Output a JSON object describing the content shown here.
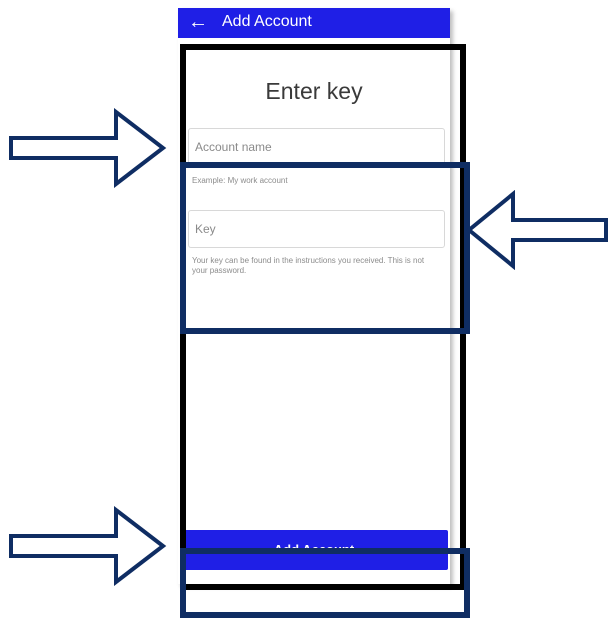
{
  "appbar": {
    "back_icon": "arrow-left-icon",
    "back_glyph": "←",
    "title": "Add Account"
  },
  "form": {
    "heading": "Enter key",
    "account_name": {
      "placeholder": "Account name",
      "value": "",
      "helper": "Example: My work account"
    },
    "key": {
      "placeholder": "Key",
      "value": "",
      "helper": "Your key can be found in the instructions you received. This is not your password."
    }
  },
  "actions": {
    "add_account_label": "Add Account"
  },
  "annotations": {
    "arrow_icon": "right-arrow-icon",
    "left_arrow_icon": "left-arrow-icon",
    "frame_color_black": "#000000",
    "frame_color_navy": "#0f2d63"
  },
  "colors": {
    "accent": "#1f1fe6",
    "annotation": "#0f2d63"
  }
}
